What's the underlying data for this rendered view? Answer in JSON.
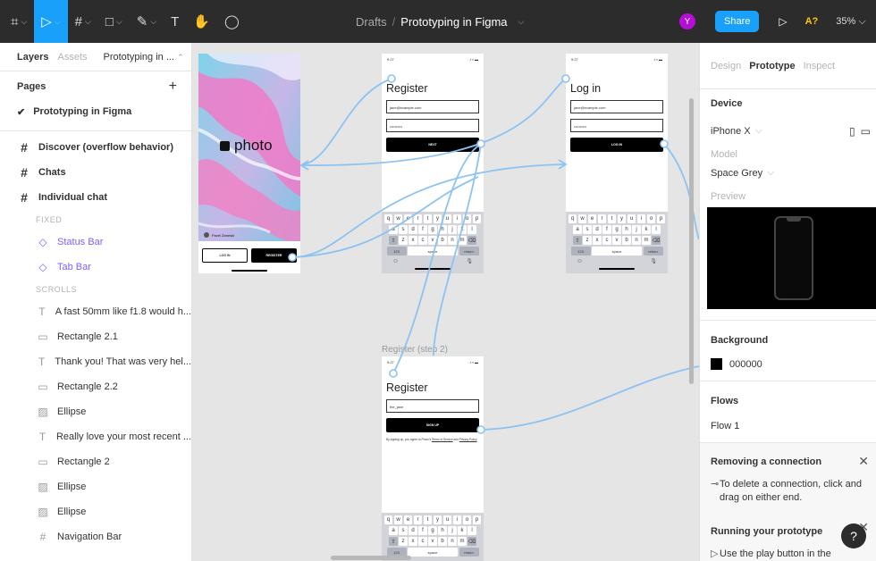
{
  "toolbar": {
    "tools": [
      {
        "name": "figma-menu",
        "glyph": "⌗"
      },
      {
        "name": "move-tool",
        "glyph": "▷"
      },
      {
        "name": "frame-tool",
        "glyph": "#"
      },
      {
        "name": "shape-tool",
        "glyph": "□"
      },
      {
        "name": "pen-tool",
        "glyph": "✎"
      },
      {
        "name": "text-tool",
        "glyph": "T"
      },
      {
        "name": "hand-tool",
        "glyph": "✋"
      },
      {
        "name": "comment-tool",
        "glyph": "◯"
      }
    ],
    "folder": "Drafts",
    "separator": "/",
    "file_name": "Prototyping in Figma",
    "user_initial": "Y",
    "share_label": "Share",
    "present_glyph": "▷",
    "a_badge": "A?",
    "zoom": "35%"
  },
  "left_panel": {
    "tabs": {
      "layers": "Layers",
      "assets": "Assets",
      "page": "Prototyping in ..."
    },
    "pages_title": "Pages",
    "add_glyph": "+",
    "current_page": "Prototyping in Figma",
    "check_glyph": "✔",
    "layers": [
      {
        "kind": "frame",
        "icon": "#",
        "label": "Discover (overflow behavior)"
      },
      {
        "kind": "frame",
        "icon": "#",
        "label": "Chats"
      },
      {
        "kind": "frame",
        "icon": "#",
        "label": "Individual chat"
      },
      {
        "kind": "section",
        "icon": "",
        "label": "FIXED"
      },
      {
        "kind": "comp",
        "icon": "◇",
        "label": "Status Bar"
      },
      {
        "kind": "comp",
        "icon": "◇",
        "label": "Tab Bar"
      },
      {
        "kind": "section",
        "icon": "",
        "label": "SCROLLS"
      },
      {
        "kind": "child",
        "icon": "T",
        "label": "A fast 50mm like f1.8 would h..."
      },
      {
        "kind": "child",
        "icon": "▭",
        "label": "Rectangle 2.1"
      },
      {
        "kind": "child",
        "icon": "T",
        "label": "Thank you! That was very hel..."
      },
      {
        "kind": "child",
        "icon": "▭",
        "label": "Rectangle 2.2"
      },
      {
        "kind": "child",
        "icon": "▨",
        "label": "Ellipse"
      },
      {
        "kind": "child",
        "icon": "T",
        "label": "Really love your most recent ..."
      },
      {
        "kind": "child",
        "icon": "▭",
        "label": "Rectangle 2"
      },
      {
        "kind": "child",
        "icon": "▨",
        "label": "Ellipse"
      },
      {
        "kind": "child",
        "icon": "▨",
        "label": "Ellipse"
      },
      {
        "kind": "child",
        "icon": "#",
        "label": "Navigation Bar"
      }
    ]
  },
  "canvas": {
    "hero": {
      "logo_text": "photo",
      "user_name": "Pavel Zaneski",
      "btn_login": "LOG IN",
      "btn_register": "REGISTER"
    },
    "register": {
      "time": "9:27",
      "signal": "..l ≈ ▬",
      "title": "Register",
      "email": "jane@example.com",
      "password": "••••••••••",
      "button": "NEXT"
    },
    "login": {
      "time": "9:27",
      "signal": "..l ≈ ▬",
      "title": "Log in",
      "email": "jane@example.com",
      "password": "••••••••••",
      "button": "LOG IN"
    },
    "register2": {
      "frame_label": "Register (step 2)",
      "time": "9:27",
      "signal": "..l ≈ ▬",
      "title": "Register",
      "username": "the_jane",
      "button": "SIGN UP",
      "legal_prefix": "By signing up, you agree to Photo's ",
      "legal_terms": "Terms of Service",
      "legal_mid": " and ",
      "legal_privacy": "Privacy Policy"
    },
    "keyboard": {
      "row1": [
        "q",
        "w",
        "e",
        "r",
        "t",
        "y",
        "u",
        "i",
        "o",
        "p"
      ],
      "row2": [
        "a",
        "s",
        "d",
        "f",
        "g",
        "h",
        "j",
        "k",
        "l"
      ],
      "row3": [
        "⇧",
        "z",
        "x",
        "c",
        "v",
        "b",
        "n",
        "m",
        "⌫"
      ],
      "num": "123",
      "space": "space",
      "ret": "return",
      "emoji": "☺",
      "mic": "🎙"
    }
  },
  "right_panel": {
    "tabs": {
      "design": "Design",
      "prototype": "Prototype",
      "inspect": "Inspect"
    },
    "device_title": "Device",
    "device": "iPhone X",
    "model_label": "Model",
    "model": "Space Grey",
    "preview_label": "Preview",
    "background_title": "Background",
    "background_hex": "000000",
    "flows_title": "Flows",
    "flow_1": "Flow 1",
    "remove_title": "Removing a connection",
    "remove_text": "To delete a connection, click and drag on either end.",
    "running_title": "Running your prototype",
    "running_text": "Use the play button in the",
    "close_glyph": "✕",
    "help_glyph": "?",
    "chev": "⌵"
  }
}
